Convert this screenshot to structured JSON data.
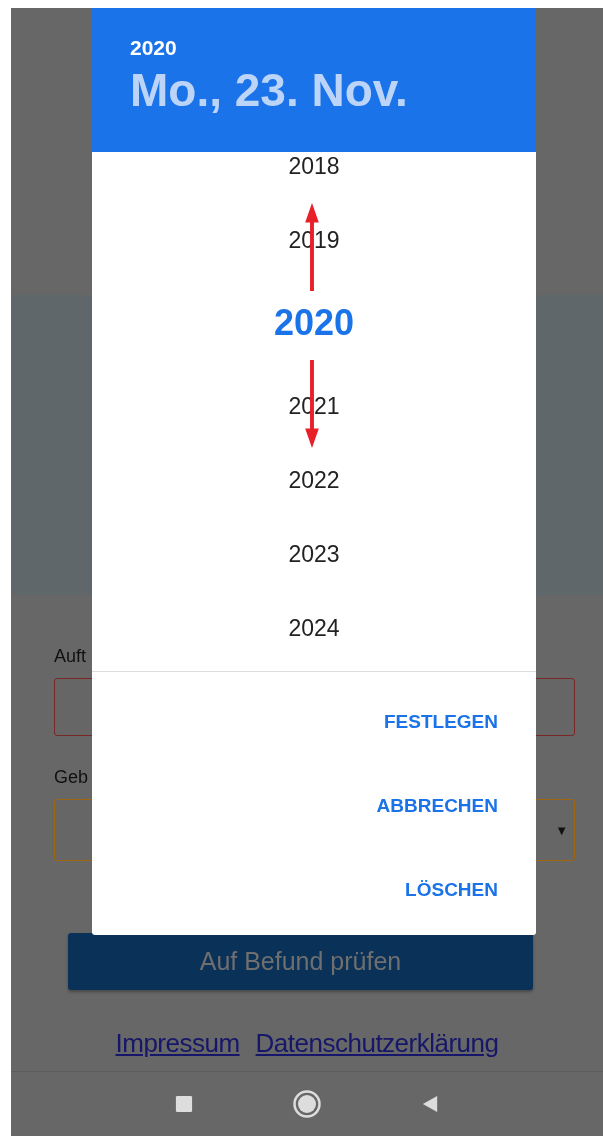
{
  "background_page": {
    "fields": [
      {
        "label": "Auft",
        "kind": "text",
        "color": "#7a2626"
      },
      {
        "label": "Geb",
        "kind": "select",
        "color": "#a0650f",
        "arrow": "▼"
      }
    ],
    "submit_button": "Auf Befund prüfen",
    "footer_links": [
      "Impressum",
      "Datenschutzerklärung"
    ]
  },
  "date_picker": {
    "header": {
      "year": "2020",
      "date": "Mo., 23. Nov."
    },
    "years": [
      {
        "label": "2018",
        "selected": false
      },
      {
        "label": "2019",
        "selected": false
      },
      {
        "label": "2020",
        "selected": true
      },
      {
        "label": "2021",
        "selected": false
      },
      {
        "label": "2022",
        "selected": false
      },
      {
        "label": "2023",
        "selected": false
      },
      {
        "label": "2024",
        "selected": false
      }
    ],
    "actions": [
      "FESTLEGEN",
      "ABBRECHEN",
      "LÖSCHEN"
    ]
  }
}
